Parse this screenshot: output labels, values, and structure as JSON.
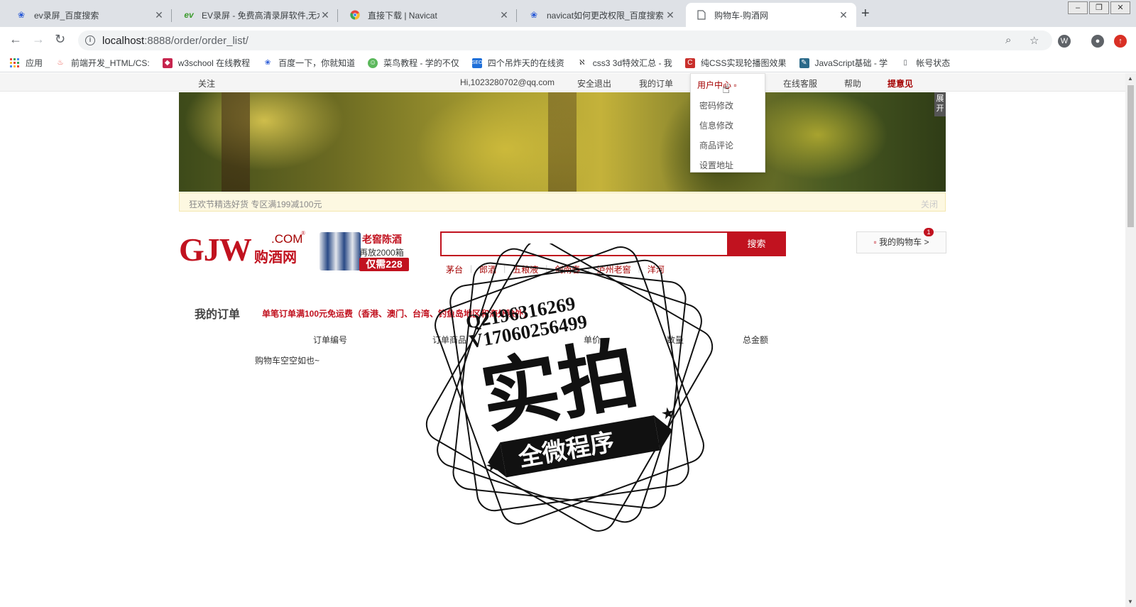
{
  "browser": {
    "tabs": [
      {
        "title": "ev录屏_百度搜索",
        "icon": "baidu-paw-icon",
        "active": false
      },
      {
        "title": "EV录屏 - 免费高清录屏软件,无水",
        "icon": "ev-logo-icon",
        "active": false
      },
      {
        "title": "直接下载 | Navicat",
        "icon": "chrome-icon",
        "active": false
      },
      {
        "title": "navicat如何更改权限_百度搜索",
        "icon": "baidu-paw-icon",
        "active": false
      },
      {
        "title": "购物车-购酒网",
        "icon": "page-icon",
        "active": true
      }
    ],
    "url_host": "localhost",
    "url_rest": ":8888/order/order_list/",
    "bookmarks": [
      {
        "label": "应用",
        "icon": "apps-grid-icon"
      },
      {
        "label": "前端开发_HTML/CS:",
        "icon": "flame-icon"
      },
      {
        "label": "w3school 在线教程",
        "icon": "w3school-icon"
      },
      {
        "label": "百度一下，你就知道",
        "icon": "baidu-paw-icon"
      },
      {
        "label": "菜鸟教程 - 学的不仅",
        "icon": "runoob-icon"
      },
      {
        "label": "四个吊炸天的在线资",
        "icon": "seo-icon"
      },
      {
        "label": "css3 3d特效汇总 - 我",
        "icon": "css-icon"
      },
      {
        "label": "纯CSS实现轮播图效果",
        "icon": "csdn-icon"
      },
      {
        "label": "JavaScript基础 - 学",
        "icon": "js-icon"
      },
      {
        "label": "帐号状态",
        "icon": "page-icon"
      }
    ],
    "colors": {
      "tabstrip": "#dee1e6",
      "accent_red": "#c1121f"
    }
  },
  "site": {
    "topbar": {
      "follow": "关注",
      "greeting": "Hi,1023280702@qq.com",
      "logout": "安全退出",
      "my_orders": "我的订单",
      "user_center": "用户中心",
      "online_service": "在线客服",
      "help": "帮助",
      "feedback": "提意见"
    },
    "user_menu": {
      "items": [
        "密码修改",
        "信息修改",
        "商品评论",
        "设置地址"
      ]
    },
    "banner": {
      "expand_label": "展开"
    },
    "notice": {
      "text": "狂欢节精选好货 专区满199减100元",
      "close": "关闭"
    },
    "logo": {
      "en": "GJW",
      "com": ".COM",
      "cn": "购酒网",
      "reg": "®"
    },
    "promo": {
      "line1": "老窖陈酒",
      "line2": "再放2000箱",
      "price": "仅需228"
    },
    "search": {
      "placeholder": "",
      "button": "搜索"
    },
    "hotwords": [
      "茅台",
      "郎酒",
      "五粮液",
      "剑南春",
      "泸州老窖",
      "洋河"
    ],
    "cart": {
      "label": "我的购物车 >",
      "count": "1"
    }
  },
  "orders": {
    "title": "我的订单",
    "note": "单笔订单满100元免运费（香港、澳门、台湾、钓鱼岛地区和海外除外）",
    "columns": [
      "订单编号",
      "订单商品",
      "单价",
      "数量",
      "总金额"
    ],
    "empty_text": "购物车空空如也~"
  },
  "watermark": {
    "line1": "Q2196316269",
    "line2": "V17060256499",
    "big": "实拍",
    "ribbon": "全微程序"
  }
}
